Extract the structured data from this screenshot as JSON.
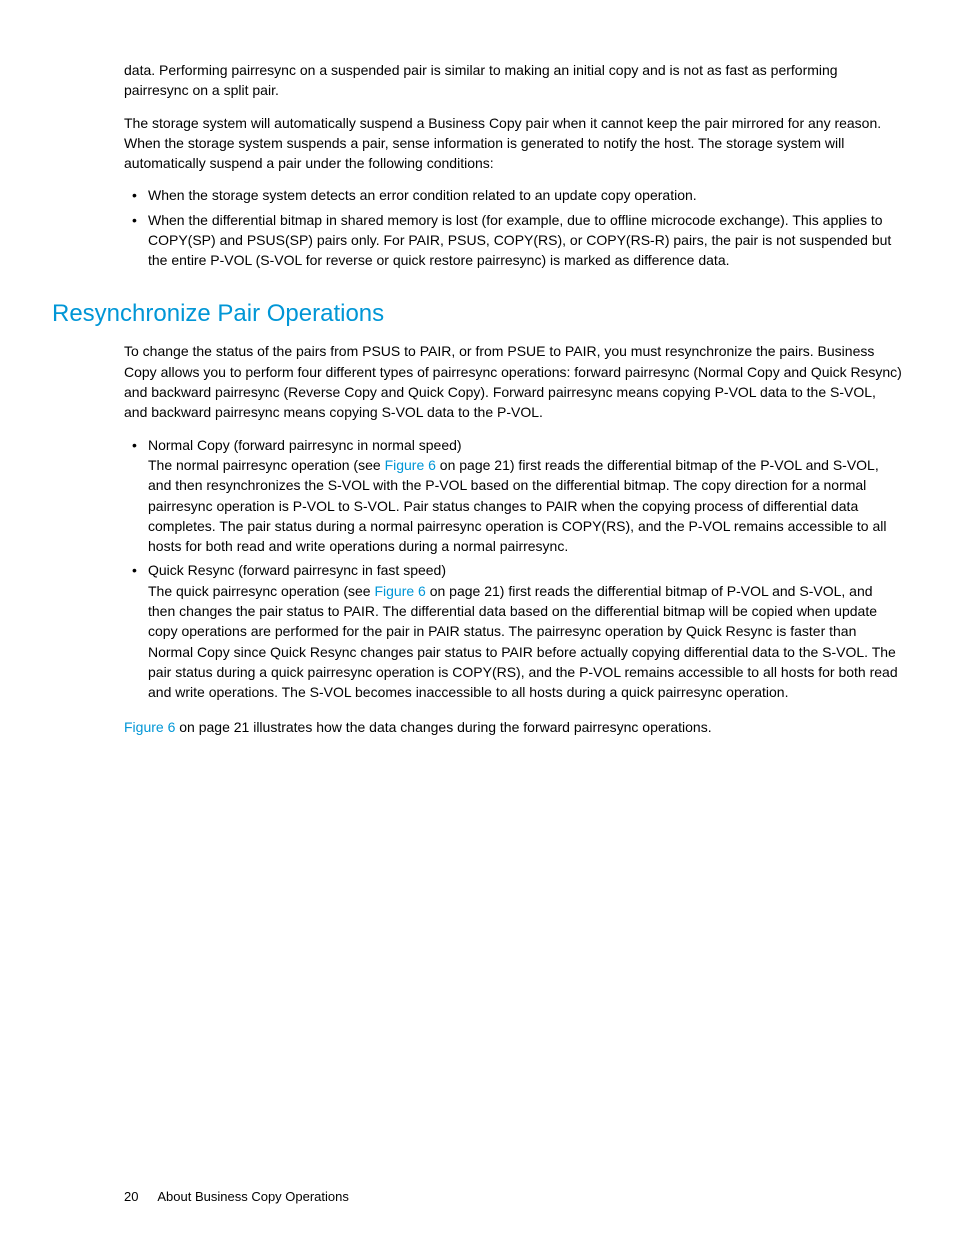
{
  "intro": {
    "p1": "data. Performing pairresync on a suspended pair is similar to making an initial copy and is not as fast as performing pairresync on a split pair.",
    "p2": "The storage system will automatically suspend a Business Copy pair when it cannot keep the pair mirrored for any reason. When the storage system suspends a pair, sense information is generated to notify the host. The storage system will automatically suspend a pair under the following conditions:",
    "bullets": [
      "When the storage system detects an error condition related to an update copy operation.",
      "When the differential bitmap in shared memory is lost (for example, due to offline microcode exchange). This applies to COPY(SP) and PSUS(SP) pairs only. For PAIR, PSUS, COPY(RS), or COPY(RS-R) pairs, the pair is not suspended but the entire P-VOL (S-VOL for reverse or quick restore pairresync) is marked as difference data."
    ]
  },
  "section": {
    "heading": "Resynchronize Pair Operations",
    "p1": "To change the status of the pairs from PSUS to PAIR, or from PSUE to PAIR, you must resynchronize the pairs. Business Copy allows you to perform four different types of pairresync operations: forward pairresync (Normal Copy and Quick Resync) and backward pairresync (Reverse Copy and Quick Copy). Forward pairresync means copying P-VOL data to the S-VOL, and backward pairresync means copying S-VOL data to the P-VOL.",
    "items": [
      {
        "title": "Normal Copy (forward pairresync in normal speed)",
        "pre": "The normal pairresync operation (see ",
        "xref": "Figure 6",
        "post": " on page 21) first reads the differential bitmap of the P-VOL and S-VOL, and then resynchronizes the S-VOL with the P-VOL based on the differential bitmap. The copy direction for a normal pairresync operation is P-VOL to S-VOL. Pair status changes to PAIR when the copying process of differential data completes. The pair status during a normal pairresync operation is COPY(RS), and the P-VOL remains accessible to all hosts for both read and write operations during a normal pairresync."
      },
      {
        "title": "Quick Resync (forward pairresync in fast speed)",
        "pre": "The quick pairresync operation (see ",
        "xref": "Figure 6",
        "post": " on page 21) first reads the differential bitmap of P-VOL and S-VOL, and then changes the pair status to PAIR. The differential data based on the differential bitmap will be copied when update copy operations are performed for the pair in PAIR status. The pairresync operation by Quick Resync is faster than Normal Copy since Quick Resync changes pair status to PAIR before actually copying differential data to the S-VOL. The pair status during a quick pairresync operation is COPY(RS), and the P-VOL remains accessible to all hosts for both read and write operations. The S-VOL becomes inaccessible to all hosts during a quick pairresync operation."
      }
    ],
    "trailing_xref": "Figure 6",
    "trailing": " on page 21 illustrates how the data changes during the forward pairresync operations."
  },
  "footer": {
    "pageno": "20",
    "title": "About Business Copy Operations"
  }
}
